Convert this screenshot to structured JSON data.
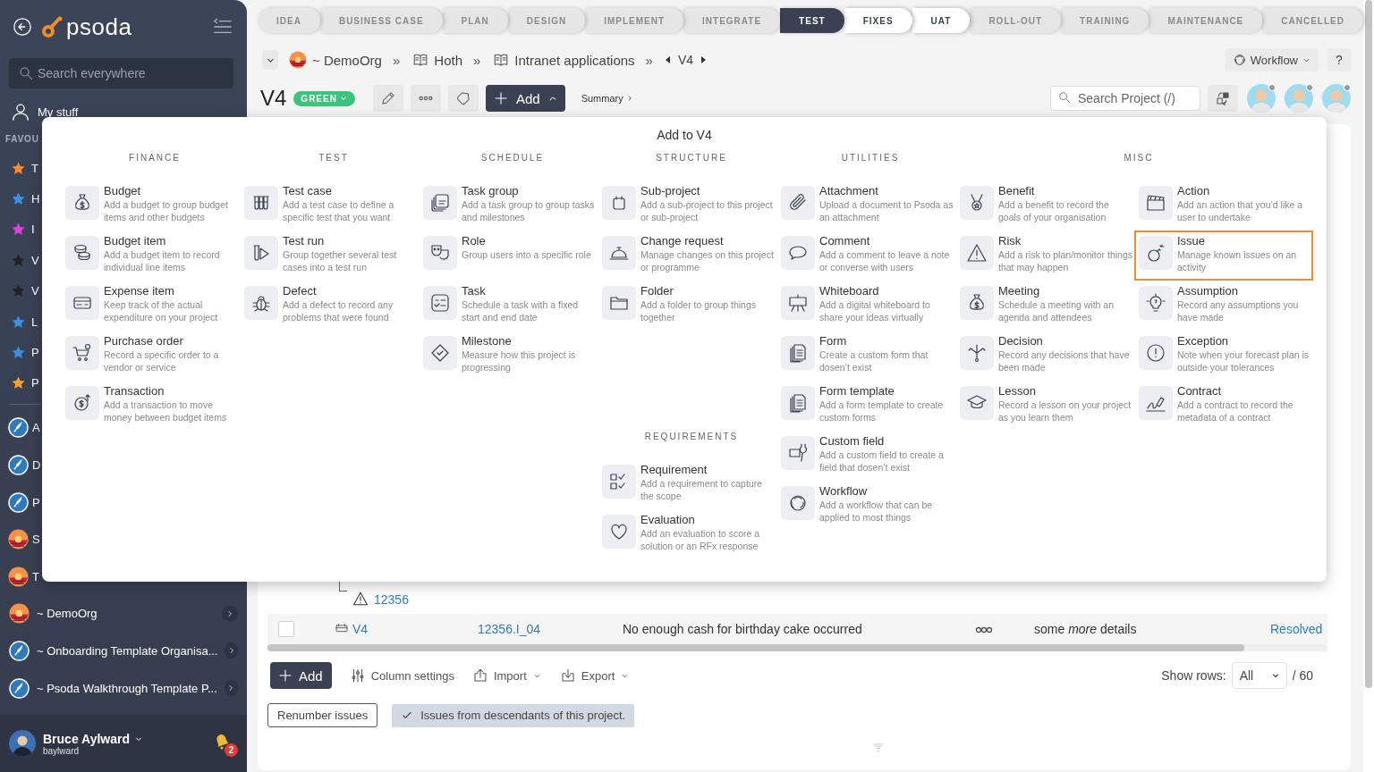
{
  "sidebar": {
    "logo": "psoda",
    "search": {
      "placeholder": "Search everywhere"
    },
    "my_stuff": "My stuff",
    "favourites_heading": "FAVOU",
    "favourites": [
      {
        "label": "T",
        "color": "#f28a30"
      },
      {
        "label": "H",
        "color": "#3d8fe0"
      },
      {
        "label": "I",
        "color": "#e040e0"
      },
      {
        "label": "V",
        "color": "#222222"
      },
      {
        "label": "V",
        "color": "#222222"
      },
      {
        "label": "L",
        "color": "#3d8fe0"
      },
      {
        "label": "P",
        "color": "#3d8fe0"
      },
      {
        "label": "P",
        "color": "#f2a030"
      }
    ],
    "recent": [
      {
        "label": "A",
        "kind": "rocket"
      },
      {
        "label": "D",
        "kind": "rocket"
      },
      {
        "label": "P",
        "kind": "rocket"
      },
      {
        "label": "S"
      },
      {
        "label": "T"
      }
    ],
    "orgs": [
      {
        "label": "~ DemoOrg"
      },
      {
        "label": "~ Onboarding Template Organisa...",
        "kind": "rocket"
      },
      {
        "label": "~ Psoda Walkthrough Template P...",
        "kind": "rocket"
      }
    ],
    "user": {
      "name": "Bruce Aylward",
      "username": "baylward",
      "notifications": "2"
    }
  },
  "phases": [
    {
      "label": "IDEA",
      "selected": false,
      "available": false
    },
    {
      "label": "BUSINESS CASE",
      "selected": false,
      "available": false
    },
    {
      "label": "PLAN",
      "selected": false,
      "available": false
    },
    {
      "label": "DESIGN",
      "selected": false,
      "available": false
    },
    {
      "label": "IMPLEMENT",
      "selected": false,
      "available": false
    },
    {
      "label": "INTEGRATE",
      "selected": false,
      "available": false
    },
    {
      "label": "TEST",
      "selected": true,
      "available": false
    },
    {
      "label": "FIXES",
      "selected": false,
      "available": true
    },
    {
      "label": "UAT",
      "selected": false,
      "available": true
    },
    {
      "label": "ROLL-OUT",
      "selected": false,
      "available": false
    },
    {
      "label": "TRAINING",
      "selected": false,
      "available": false
    },
    {
      "label": "MAINTENANCE",
      "selected": false,
      "available": false
    },
    {
      "label": "CANCELLED",
      "selected": false,
      "available": false
    }
  ],
  "breadcrumb": {
    "items": [
      {
        "label": "~ DemoOrg",
        "kind": "org",
        "separator": "»"
      },
      {
        "label": "Hoth",
        "kind": "book",
        "separator": "»"
      },
      {
        "label": "Intranet applications",
        "kind": "book",
        "separator": "»"
      }
    ],
    "current": "V4",
    "workflow": "Workflow",
    "help": "?"
  },
  "header": {
    "title": "V4",
    "status": "GREEN",
    "add": "Add",
    "summary": "Summary",
    "search": {
      "placeholder": "Search Project (/)"
    }
  },
  "table": {
    "rows": [
      {
        "kind": "partial",
        "link": "12356"
      },
      {
        "kind": "full",
        "checked": false,
        "name": "V4",
        "id": "12356.I_04",
        "title": "No enough cash for birthday cake occurred",
        "details": "some *more* details",
        "status": "Resolved"
      }
    ]
  },
  "toolbar": {
    "add": "Add",
    "column_settings": "Column settings",
    "import": "Import",
    "export": "Export",
    "show_rows_label": "Show rows:",
    "show_rows_value": "All",
    "total": "/ 60"
  },
  "footer": {
    "renumber": "Renumber issues",
    "descendants": {
      "label": "Issues from descendants of this project.",
      "on": true
    }
  },
  "menu": {
    "title": "Add to V4",
    "columns": [
      {
        "kind": "single",
        "sections": [
          {
            "heading": "FINANCE",
            "items": [
              {
                "title": "Budget",
                "description": "Add a budget to group budget items and other budgets",
                "selected": false
              },
              {
                "title": "Budget item",
                "description": "Add a budget item to record individual line items",
                "selected": false
              },
              {
                "title": "Expense item",
                "description": "Keep track of the actual expenditure on your project",
                "selected": false
              },
              {
                "title": "Purchase order",
                "description": "Record a specific order to a vendor or service",
                "selected": false
              },
              {
                "title": "Transaction",
                "description": "Add a transaction to move money between budget items",
                "selected": false
              }
            ]
          }
        ]
      },
      {
        "kind": "single",
        "sections": [
          {
            "heading": "TEST",
            "items": [
              {
                "title": "Test case",
                "description": "Add a test case to define a specific test that you want",
                "selected": false
              },
              {
                "title": "Test run",
                "description": "Group together several test cases into a test run",
                "selected": false
              },
              {
                "title": "Defect",
                "description": "Add a defect to record any problems that were found",
                "selected": false
              }
            ]
          }
        ]
      },
      {
        "kind": "single",
        "sections": [
          {
            "heading": "SCHEDULE",
            "items": [
              {
                "title": "Task group",
                "description": "Add a task group to group tasks and milestones",
                "selected": false
              },
              {
                "title": "Role",
                "description": "Group users into a specific role",
                "selected": false
              },
              {
                "title": "Task",
                "description": "Schedule a task with a fixed start and end date",
                "selected": false
              },
              {
                "title": "Milestone",
                "description": "Measure how this project is progressing",
                "selected": false
              }
            ]
          }
        ]
      },
      {
        "kind": "single",
        "sections": [
          {
            "heading": "STRUCTURE",
            "items": [
              {
                "title": "Sub-project",
                "description": "Add a sub-project to this project or sub-project",
                "selected": false
              },
              {
                "title": "Change request",
                "description": "Manage changes on this project or programme",
                "selected": false
              },
              {
                "title": "Folder",
                "description": "Add a folder to group things together",
                "selected": false
              }
            ]
          },
          {
            "heading": "REQUIREMENTS",
            "items": [
              {
                "title": "Requirement",
                "description": "Add a requirement to capture the scope",
                "selected": false
              },
              {
                "title": "Evaluation",
                "description": "Add an evaluation to score a solution or an RFx response",
                "selected": false
              }
            ]
          }
        ]
      },
      {
        "kind": "single",
        "sections": [
          {
            "heading": "UTILITIES",
            "items": [
              {
                "title": "Attachment",
                "description": "Upload a document to Psoda as an attachment",
                "selected": false
              },
              {
                "title": "Comment",
                "description": "Add a comment to leave a note or converse with users",
                "selected": false
              },
              {
                "title": "Whiteboard",
                "description": "Add a digital whiteboard to share your ideas virtually",
                "selected": false
              },
              {
                "title": "Form",
                "description": "Create a custom form that dosen’t exist",
                "selected": false
              },
              {
                "title": "Form template",
                "description": "Add a form template to create custom forms",
                "selected": false
              },
              {
                "title": "Custom field",
                "description": "Add a custom field to create a field that dosen’t exist",
                "selected": false
              },
              {
                "title": "Workflow",
                "description": "Add a workflow that can be applied to most things",
                "selected": false
              }
            ]
          }
        ]
      },
      {
        "kind": "double",
        "sections": [
          {
            "heading": "MISC",
            "items": [
              {
                "title": "Benefit",
                "description": "Add a benefit to record the goals of your organisation",
                "selected": false
              },
              {
                "title": "Action",
                "description": "Add an action that you’d like a user to undertake",
                "selected": false
              },
              {
                "title": "Risk",
                "description": "Add a risk to plan/monitor things that may happen",
                "selected": false
              },
              {
                "title": "Issue",
                "description": "Manage known issues on an activity",
                "selected": true
              },
              {
                "title": "Meeting",
                "description": "Schedule a meeting with an agenda and attendees",
                "selected": false
              },
              {
                "title": "Assumption",
                "description": "Record any assumptions you have made",
                "selected": false
              },
              {
                "title": "Decision",
                "description": "Record any decisions that have been made",
                "selected": false
              },
              {
                "title": "Exception",
                "description": "Note when your forecast plan is outside your tolerances",
                "selected": false
              },
              {
                "title": "Lesson",
                "description": "Record a lesson on your project as you learn them",
                "selected": false
              },
              {
                "title": "Contract",
                "description": "Add a contract to record the metadata of a contract",
                "selected": false
              }
            ]
          }
        ]
      }
    ]
  }
}
